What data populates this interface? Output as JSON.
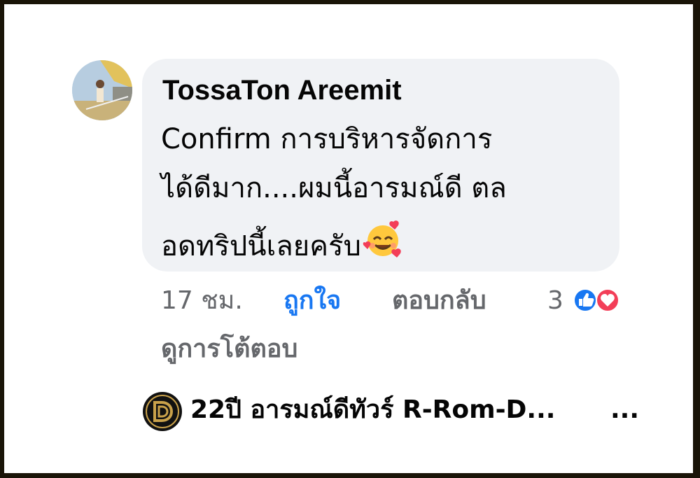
{
  "comment": {
    "author": "TossaTon Areemit",
    "text_lines": [
      "Confirm การบริหารจัดการ",
      "ได้ดีมาก....ผมนี้อารมณ์ดี ตล",
      "อดทริปนี้เลยครับ"
    ],
    "emoji": "smiling-face-with-hearts"
  },
  "meta": {
    "time": "17 ชม.",
    "like_label": "ถูกใจ",
    "reply_label": "ตอบกลับ",
    "reaction_count": "3",
    "reactions": [
      "like-icon",
      "love-icon"
    ]
  },
  "view_replies": "ดูการโต้ตอบ",
  "page": {
    "name": "22ปี อารมณ์ดีทัวร์ R-Rom-D...",
    "more": "..."
  },
  "colors": {
    "accent": "#1877f2",
    "love": "#f33e58",
    "bubble": "#f0f2f5",
    "muted": "#65676b",
    "gold": "#c9a14a"
  }
}
